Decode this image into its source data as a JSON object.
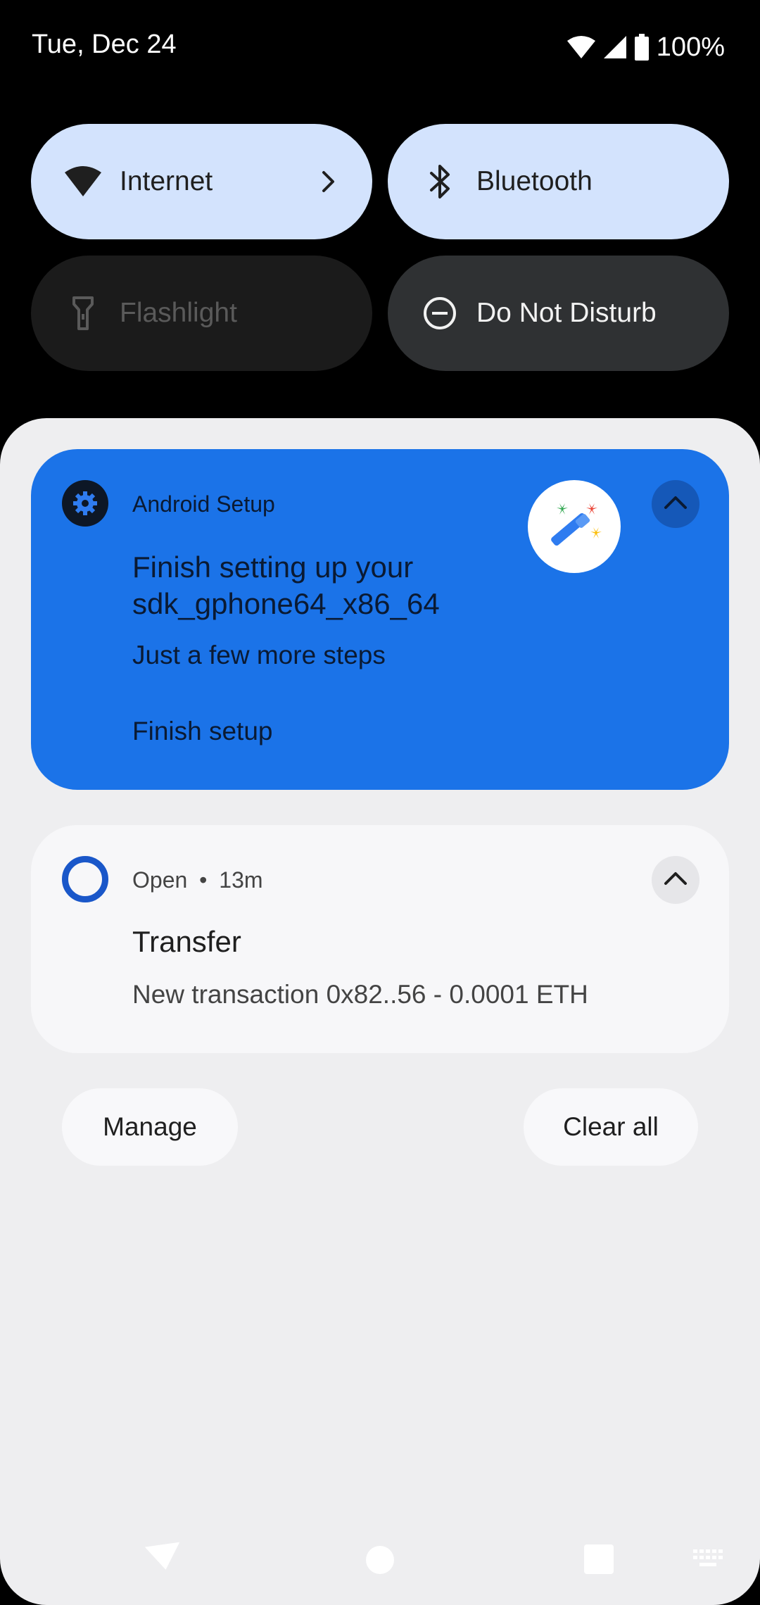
{
  "status_bar": {
    "date": "Tue, Dec 24",
    "battery": "100%",
    "icons": [
      "wifi-icon",
      "cell-signal-icon",
      "battery-icon"
    ]
  },
  "quick_settings": {
    "tiles": [
      {
        "label": "Internet",
        "icon": "wifi-icon",
        "state": "on"
      },
      {
        "label": "Bluetooth",
        "icon": "bluetooth-icon",
        "state": "on"
      },
      {
        "label": "Flashlight",
        "icon": "flashlight-icon",
        "state": "unavailable"
      },
      {
        "label": "Do Not Disturb",
        "icon": "do-not-disturb-icon",
        "state": "off"
      }
    ]
  },
  "notifications": {
    "setup": {
      "app_name": "Android Setup",
      "title": "Finish setting up your sdk_gphone64_x86_64",
      "text": "Just a few more steps",
      "action": "Finish setup"
    },
    "open": {
      "app_name": "Open",
      "separator": "•",
      "time": "13m",
      "title": "Transfer",
      "text": "New transaction 0x82..56 - 0.0001 ETH"
    }
  },
  "footer": {
    "manage_label": "Manage",
    "clear_all_label": "Clear all"
  },
  "colors": {
    "tile_on": "#d3e3fd",
    "setup_card": "#1b73e8",
    "open_icon": "#1a57c9",
    "shade": "#eeeef0"
  }
}
